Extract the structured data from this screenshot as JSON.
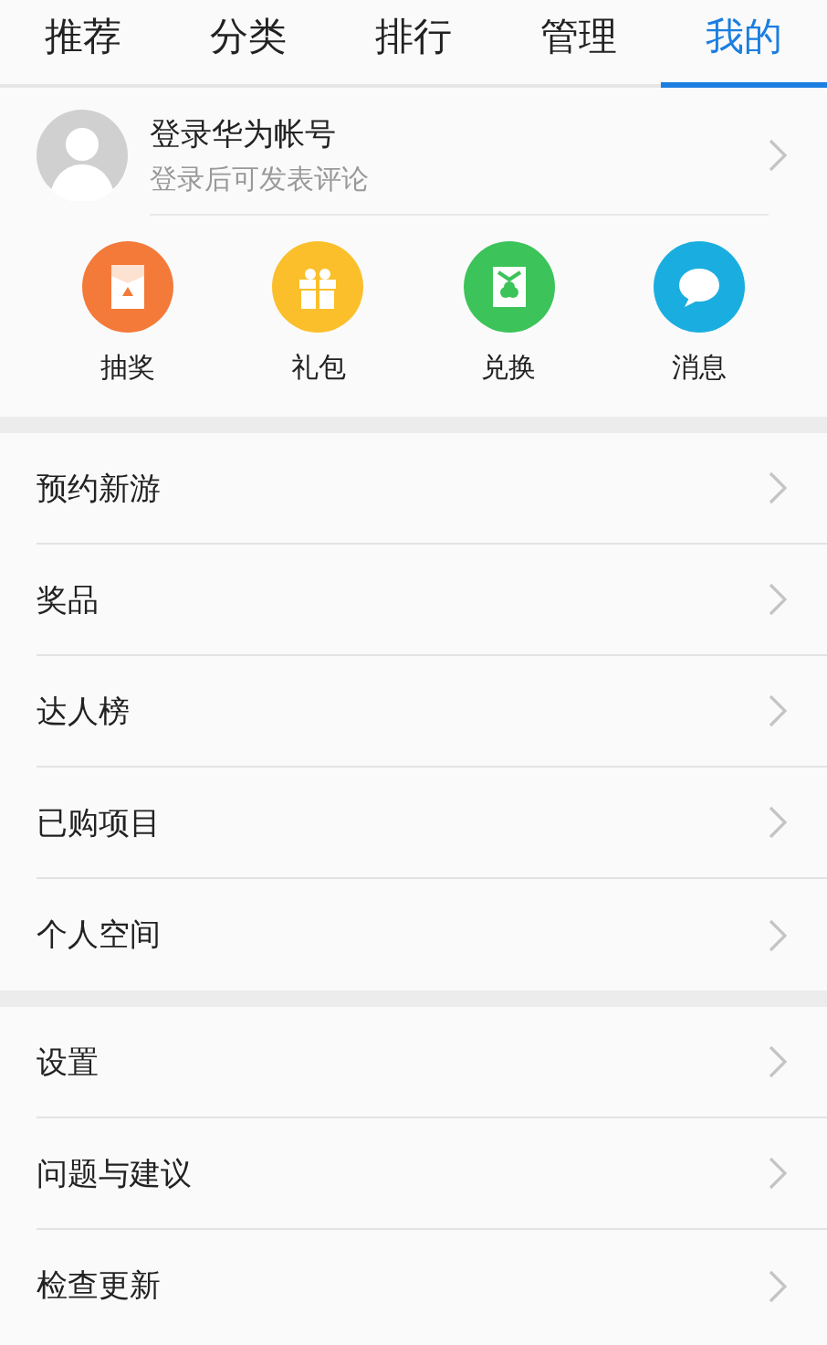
{
  "tabs": [
    {
      "label": "推荐",
      "selected": false
    },
    {
      "label": "分类",
      "selected": false
    },
    {
      "label": "排行",
      "selected": false
    },
    {
      "label": "管理",
      "selected": false
    },
    {
      "label": "我的",
      "selected": true
    }
  ],
  "account": {
    "title": "登录华为帐号",
    "subtitle": "登录后可发表评论"
  },
  "shortcuts": [
    {
      "label": "抽奖",
      "kind": "envelope",
      "color": "#f47a3a"
    },
    {
      "label": "礼包",
      "kind": "gift",
      "color": "#fbbf2b"
    },
    {
      "label": "兑换",
      "kind": "exchange",
      "color": "#3cc35a"
    },
    {
      "label": "消息",
      "kind": "chat",
      "color": "#1aaee0"
    }
  ],
  "menu_groups": [
    {
      "items": [
        "预约新游",
        "奖品",
        "达人榜",
        "已购项目",
        "个人空间"
      ]
    },
    {
      "items": [
        "设置",
        "问题与建议",
        "检查更新"
      ]
    }
  ]
}
